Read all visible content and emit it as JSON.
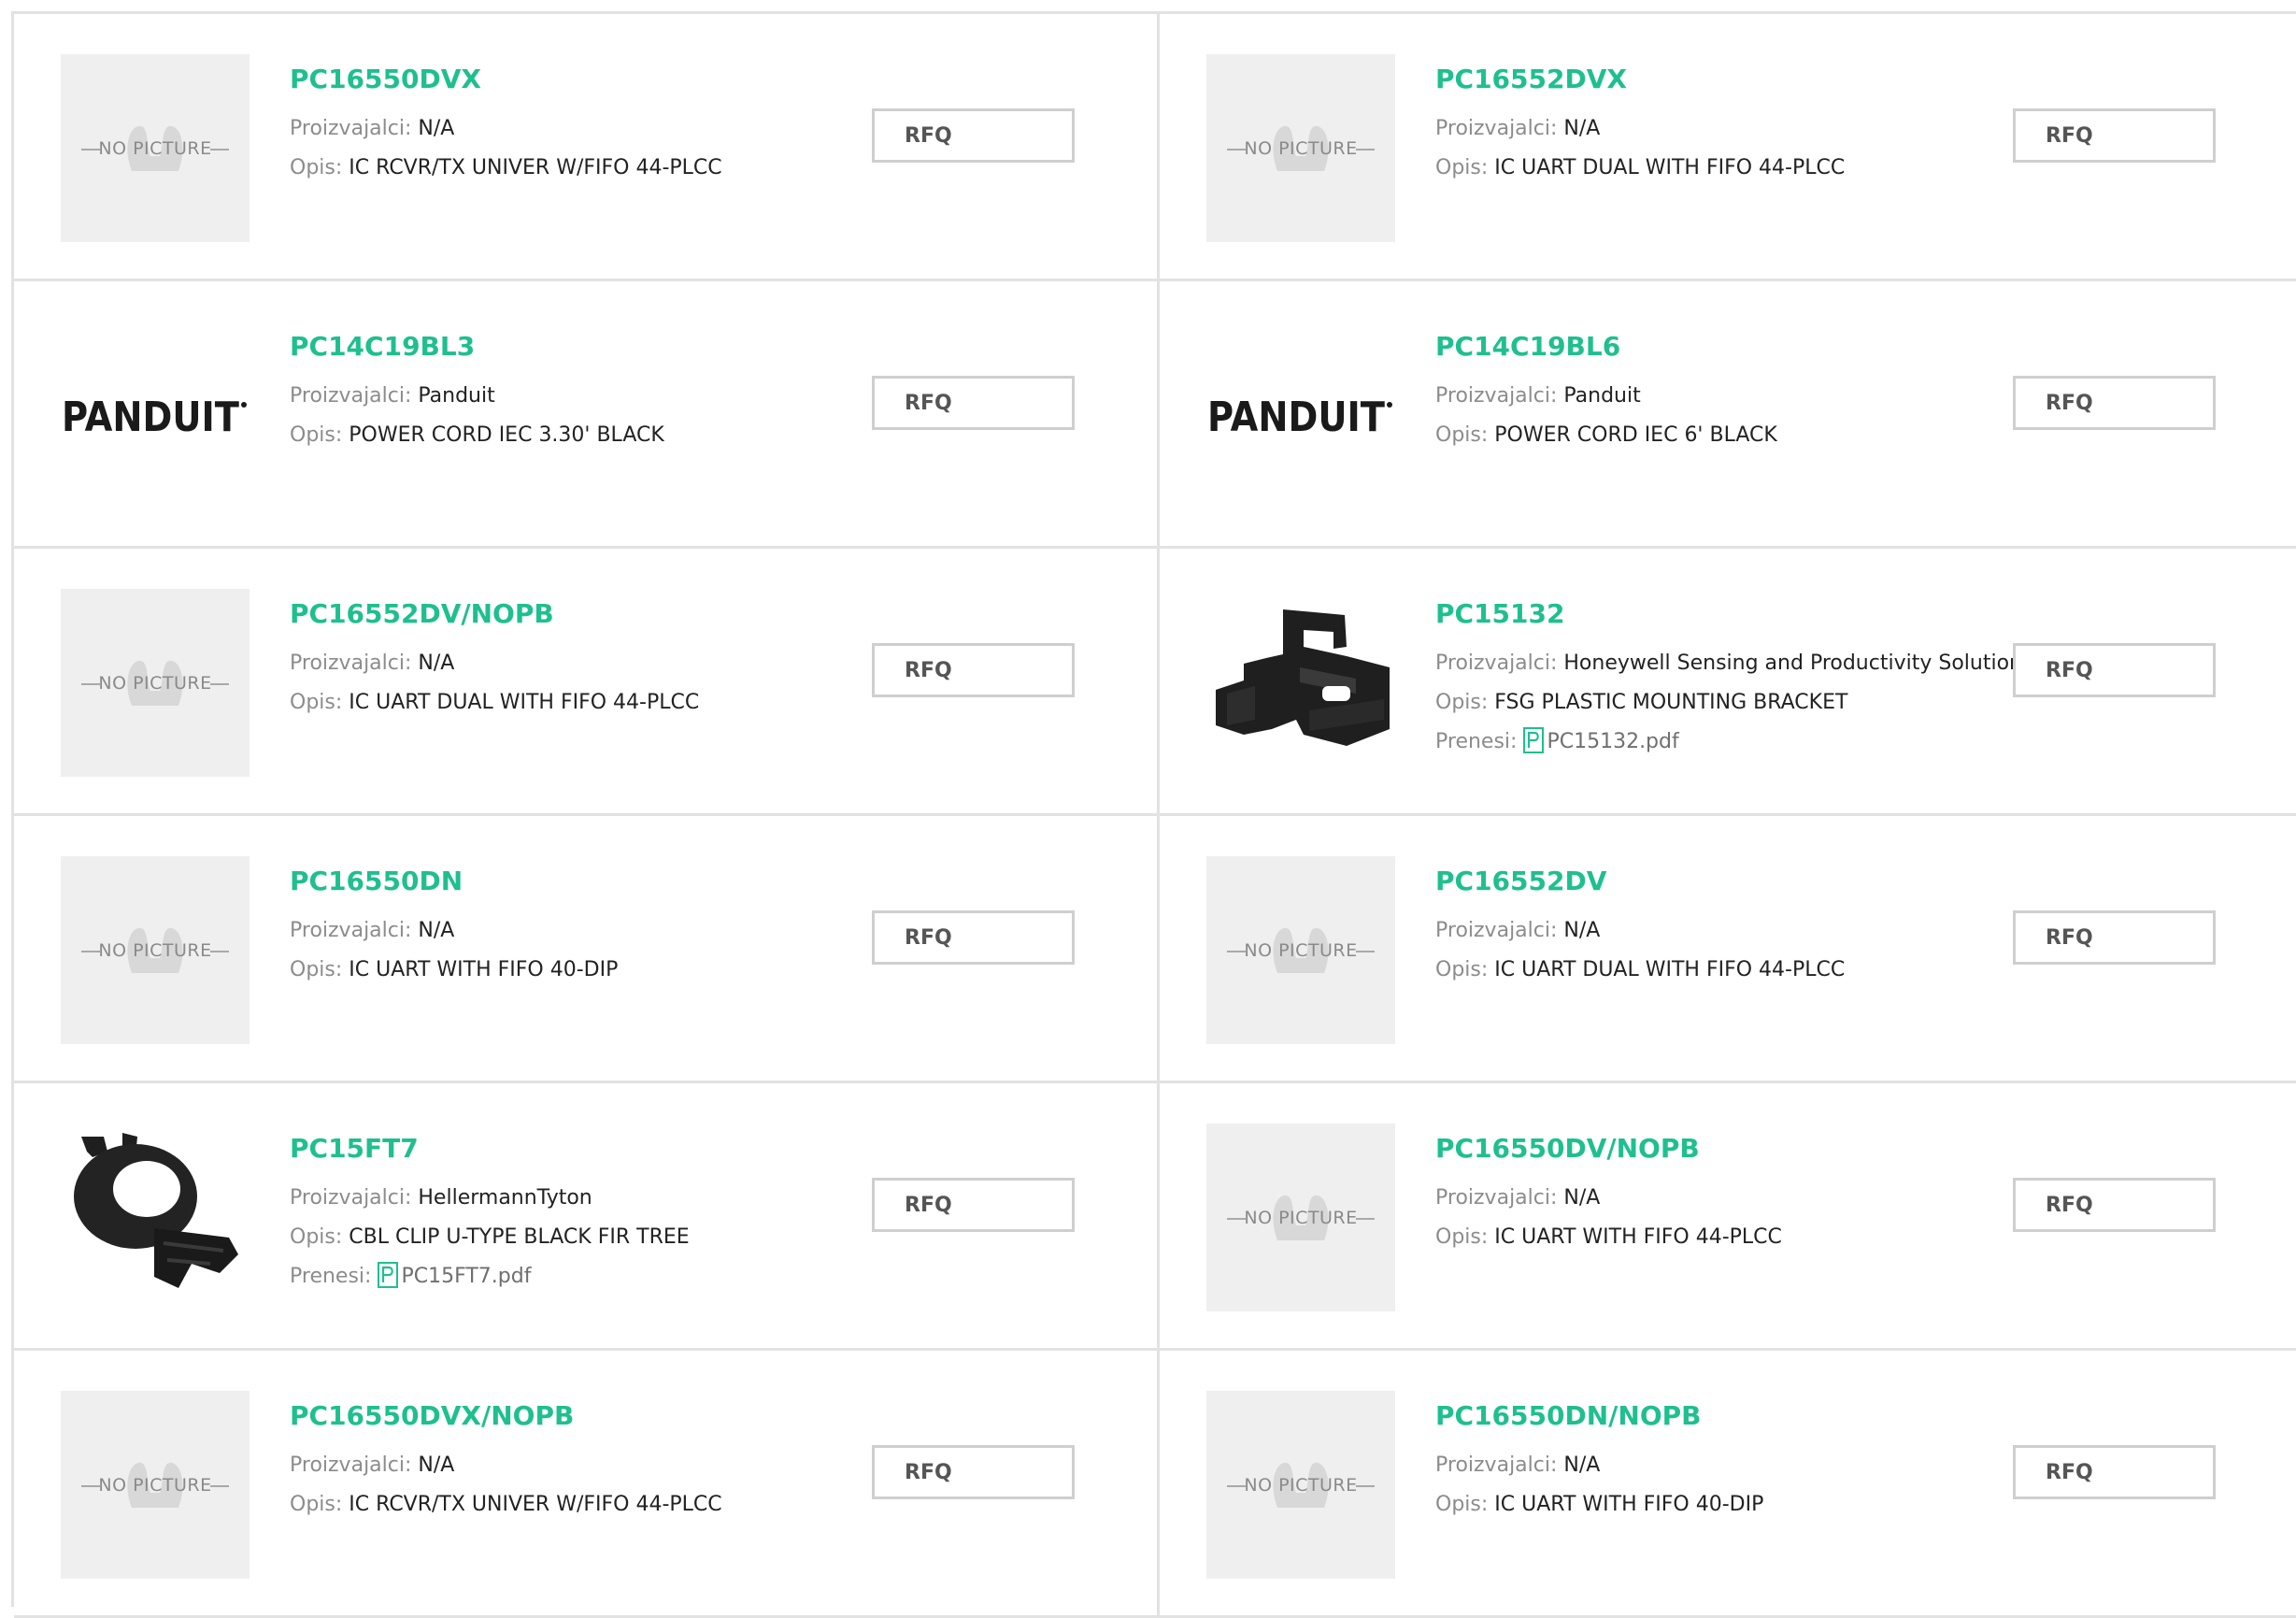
{
  "labels": {
    "manufacturer": "Proizvajalci:",
    "description": "Opis:",
    "download": "Prenesi:",
    "rfq": "RFQ",
    "no_picture": "NO PICTURE",
    "panduit_logo": "PANDUIT"
  },
  "colors": {
    "part_number": "#1fbf8f",
    "border": "#e2e2e2",
    "rfq_border": "#cfcfcf"
  },
  "products": [
    {
      "part": "PC16550DVX",
      "manufacturer": "N/A",
      "description": "IC RCVR/TX UNIVER W/FIFO 44-PLCC",
      "image": "no-picture"
    },
    {
      "part": "PC16552DVX",
      "manufacturer": "N/A",
      "description": "IC UART DUAL WITH FIFO 44-PLCC",
      "image": "no-picture"
    },
    {
      "part": "PC14C19BL3",
      "manufacturer": "Panduit",
      "description": "POWER CORD IEC 3.30' BLACK",
      "image": "panduit-logo"
    },
    {
      "part": "PC14C19BL6",
      "manufacturer": "Panduit",
      "description": "POWER CORD IEC 6' BLACK",
      "image": "panduit-logo"
    },
    {
      "part": "PC16552DV/NOPB",
      "manufacturer": "N/A",
      "description": "IC UART DUAL WITH FIFO 44-PLCC",
      "image": "no-picture"
    },
    {
      "part": "PC15132",
      "manufacturer": "Honeywell Sensing and Productivity Solutions",
      "description": "FSG PLASTIC MOUNTING BRACKET",
      "image": "bracket-photo",
      "file": "PC15132.pdf"
    },
    {
      "part": "PC16550DN",
      "manufacturer": "N/A",
      "description": "IC UART WITH FIFO 40-DIP",
      "image": "no-picture"
    },
    {
      "part": "PC16552DV",
      "manufacturer": "N/A",
      "description": "IC UART DUAL WITH FIFO 44-PLCC",
      "image": "no-picture"
    },
    {
      "part": "PC15FT7",
      "manufacturer": "HellermannTyton",
      "description": "CBL CLIP U-TYPE BLACK FIR TREE",
      "image": "clip-photo",
      "file": "PC15FT7.pdf"
    },
    {
      "part": "PC16550DV/NOPB",
      "manufacturer": "N/A",
      "description": "IC UART WITH FIFO 44-PLCC",
      "image": "no-picture"
    },
    {
      "part": "PC16550DVX/NOPB",
      "manufacturer": "N/A",
      "description": "IC RCVR/TX UNIVER W/FIFO 44-PLCC",
      "image": "no-picture"
    },
    {
      "part": "PC16550DN/NOPB",
      "manufacturer": "N/A",
      "description": "IC UART WITH FIFO 40-DIP",
      "image": "no-picture"
    }
  ]
}
